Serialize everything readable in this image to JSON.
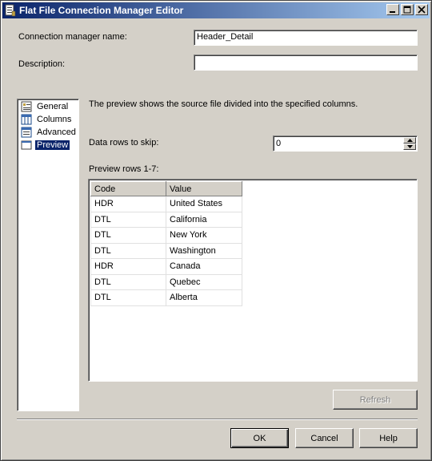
{
  "window": {
    "title": "Flat File Connection Manager Editor",
    "icon": "file-connection-icon"
  },
  "form": {
    "connection_name_label": "Connection manager name:",
    "connection_name_value": "Header_Detail",
    "description_label": "Description:",
    "description_value": ""
  },
  "nav": {
    "items": [
      {
        "label": "General",
        "icon": "general-icon"
      },
      {
        "label": "Columns",
        "icon": "columns-icon"
      },
      {
        "label": "Advanced",
        "icon": "advanced-icon"
      },
      {
        "label": "Preview",
        "icon": "preview-icon"
      }
    ],
    "selected": "Preview"
  },
  "preview": {
    "intro": "The preview shows the source file divided into the specified columns.",
    "skip_label": "Data rows to skip:",
    "skip_value": "0",
    "rows_label": "Preview rows 1-7:",
    "columns": [
      "Code",
      "Value"
    ],
    "rows": [
      [
        "HDR",
        "United States"
      ],
      [
        "DTL",
        "California"
      ],
      [
        "DTL",
        "New York"
      ],
      [
        "DTL",
        "Washington"
      ],
      [
        "HDR",
        "Canada"
      ],
      [
        "DTL",
        "Quebec"
      ],
      [
        "DTL",
        "Alberta"
      ]
    ],
    "refresh_label": "Refresh"
  },
  "buttons": {
    "ok": "OK",
    "cancel": "Cancel",
    "help": "Help"
  },
  "colors": {
    "title_start": "#0a246a",
    "title_end": "#a6caf0",
    "face": "#d4d0c8",
    "selection": "#0a246a"
  }
}
